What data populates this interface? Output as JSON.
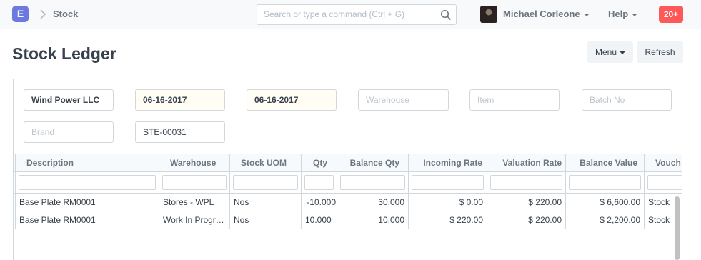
{
  "navbar": {
    "logo": "E",
    "breadcrumb": "Stock",
    "search_placeholder": "Search or type a command (Ctrl + G)",
    "user_name": "Michael Corleone",
    "help_label": "Help",
    "notifications": "20+"
  },
  "page": {
    "title": "Stock Ledger",
    "menu_label": "Menu",
    "refresh_label": "Refresh"
  },
  "filters": {
    "company": "Wind Power LLC",
    "from_date": "06-16-2017",
    "to_date": "06-16-2017",
    "warehouse_placeholder": "Warehouse",
    "item_placeholder": "Item",
    "batch_placeholder": "Batch No",
    "brand_placeholder": "Brand",
    "voucher_no": "STE-00031"
  },
  "grid": {
    "columns": [
      "Description",
      "Warehouse",
      "Stock UOM",
      "Qty",
      "Balance Qty",
      "Incoming Rate",
      "Valuation Rate",
      "Balance Value",
      "Vouch"
    ],
    "rows": [
      [
        "Base Plate RM0001",
        "Stores - WPL",
        "Nos",
        "-10.000",
        "30.000",
        "$ 0.00",
        "$ 220.00",
        "$ 6,600.00",
        "Stock"
      ],
      [
        "Base Plate RM0001",
        "Work In Progr…",
        "Nos",
        "10.000",
        "10.000",
        "$ 220.00",
        "$ 220.00",
        "$ 2,200.00",
        "Stock"
      ]
    ]
  }
}
